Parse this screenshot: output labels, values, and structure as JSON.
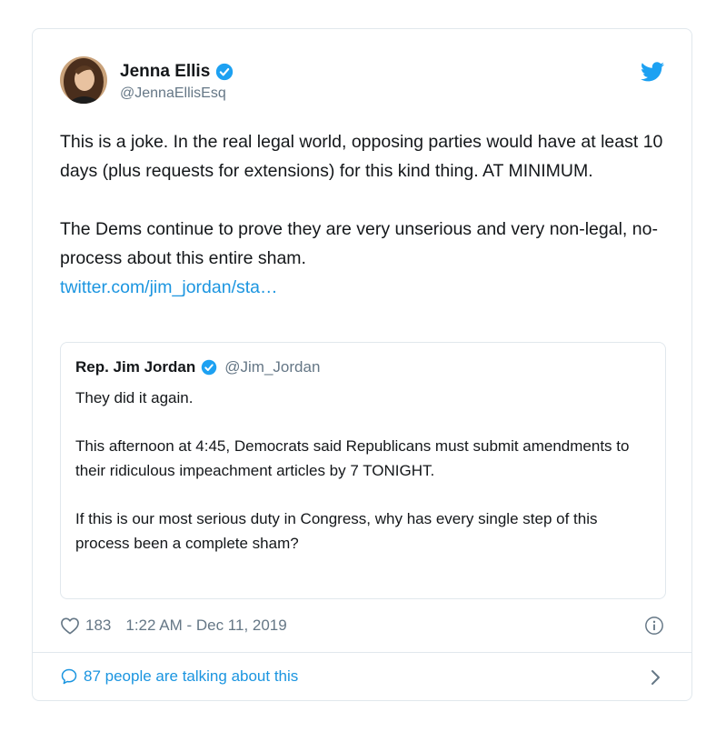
{
  "author": {
    "display_name": "Jenna Ellis",
    "handle": "@JennaEllisEsq",
    "verified": true
  },
  "tweet": {
    "paragraph1": "This is a joke. In the real legal world, opposing parties would have at least 10 days (plus requests for extensions) for this kind thing. AT MINIMUM.",
    "paragraph2": "The Dems continue to prove they are very unserious and very non-legal, no-process about this entire sham.",
    "link_text": "twitter.com/jim_jordan/sta…"
  },
  "quoted": {
    "display_name": "Rep. Jim Jordan",
    "handle": "@Jim_Jordan",
    "verified": true,
    "paragraph1": "They did it again.",
    "paragraph2": "This afternoon at 4:45, Democrats said Republicans must submit amendments to their ridiculous impeachment articles by 7 TONIGHT.",
    "paragraph3": "If this is our most serious duty in Congress, why has every single step of this process been a complete sham?"
  },
  "meta": {
    "like_count": "183",
    "timestamp": "1:22 AM - Dec 11, 2019"
  },
  "footer": {
    "talking_text": "87 people are talking about this"
  },
  "colors": {
    "accent": "#1b95e0",
    "verified": "#1da1f2",
    "secondary_text": "#657786",
    "border": "#e1e8ed"
  },
  "icons": [
    "verified-badge-icon",
    "twitter-bird-icon",
    "heart-icon",
    "info-icon",
    "speech-bubble-icon",
    "chevron-right-icon"
  ]
}
